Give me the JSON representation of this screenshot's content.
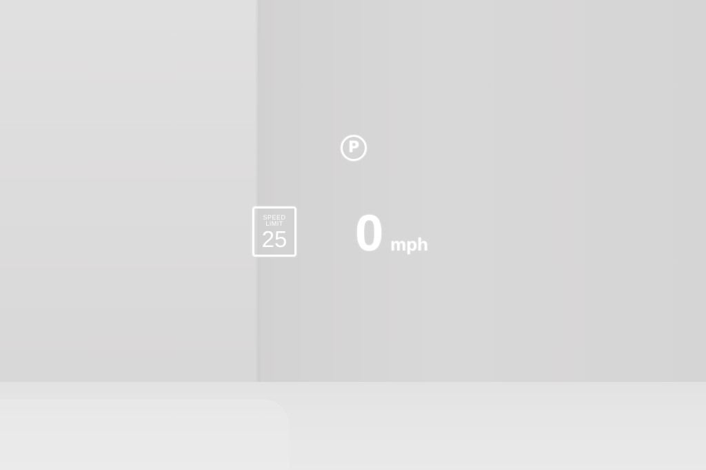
{
  "hud": {
    "gear_indicator": {
      "letter": "P",
      "icon": "park-icon"
    },
    "speed_limit_sign": {
      "line1": "SPEED",
      "line2": "LIMIT",
      "value": "25"
    },
    "speed": {
      "value": "0",
      "unit": "mph"
    }
  },
  "colors": {
    "hud_text": "#ffffff",
    "background": "#dcdbdb"
  }
}
